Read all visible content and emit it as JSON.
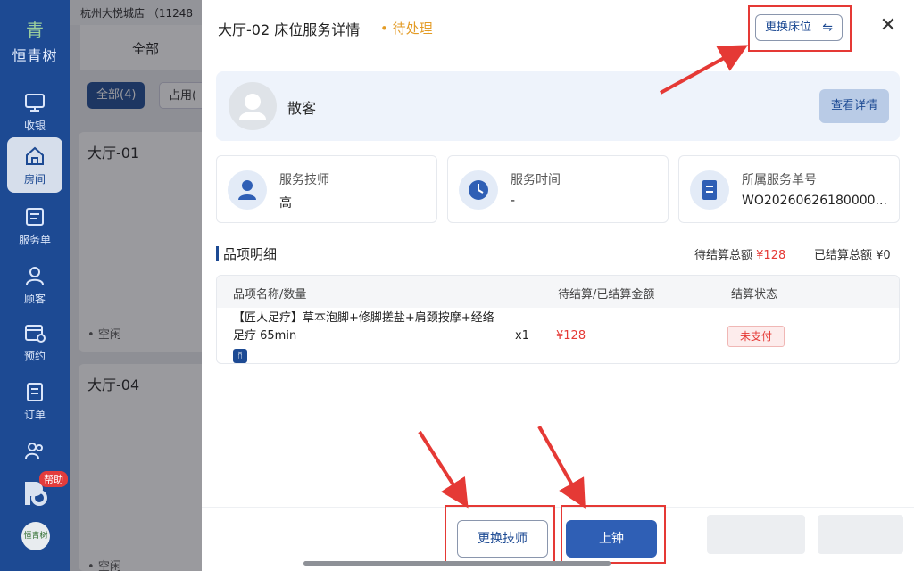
{
  "sidebar": {
    "logo_glyph": "青",
    "brand": "恒青树",
    "items": [
      {
        "label": "收银",
        "icon": "monitor-icon"
      },
      {
        "label": "房间",
        "icon": "home-icon",
        "active": true
      },
      {
        "label": "服务单",
        "icon": "service-list-icon"
      },
      {
        "label": "顾客",
        "icon": "user-icon"
      },
      {
        "label": "预约",
        "icon": "calendar-clock-icon"
      },
      {
        "label": "订单",
        "icon": "order-icon"
      }
    ],
    "help_badge": "帮助",
    "avatar_text": "恒青树"
  },
  "background": {
    "store": "杭州大悦城店 （11248",
    "tab_all": "全部",
    "filter_all": "全部(4)",
    "filter_busy": "占用(",
    "rooms": [
      {
        "name": "大厅-01",
        "status": "空闲"
      },
      {
        "name": "大厅-04",
        "status": "空闲"
      }
    ]
  },
  "drawer": {
    "title": "大厅-02 床位服务详情",
    "status": "待处理",
    "swap_bed_label": "更换床位",
    "customer": {
      "name": "散客",
      "detail_button": "查看详情"
    },
    "info": [
      {
        "label": "服务技师",
        "value": "高",
        "icon": "technician-icon"
      },
      {
        "label": "服务时间",
        "value": "-",
        "icon": "clock-icon"
      },
      {
        "label": "所属服务单号",
        "value": "WO20260626180000...",
        "icon": "document-icon"
      }
    ],
    "section_title": "品项明细",
    "pending_total_label": "待结算总额",
    "pending_total": "¥128",
    "settled_total_label": "已结算总额",
    "settled_total": "¥0",
    "table": {
      "headers": [
        "品项名称/数量",
        "待结算/已结算金额",
        "结算状态"
      ],
      "rows": [
        {
          "name": "【匠人足疗】草本泡脚+修脚搓盐+肩颈按摩+经络足疗 65min",
          "qty": "x1",
          "amount": "¥128",
          "status": "未支付"
        }
      ]
    },
    "footer": {
      "swap_tech_label": "更换技师",
      "start_label": "上钟"
    }
  },
  "colors": {
    "primary": "#1d4a93",
    "warning": "#e39b25",
    "danger": "#e53935"
  }
}
